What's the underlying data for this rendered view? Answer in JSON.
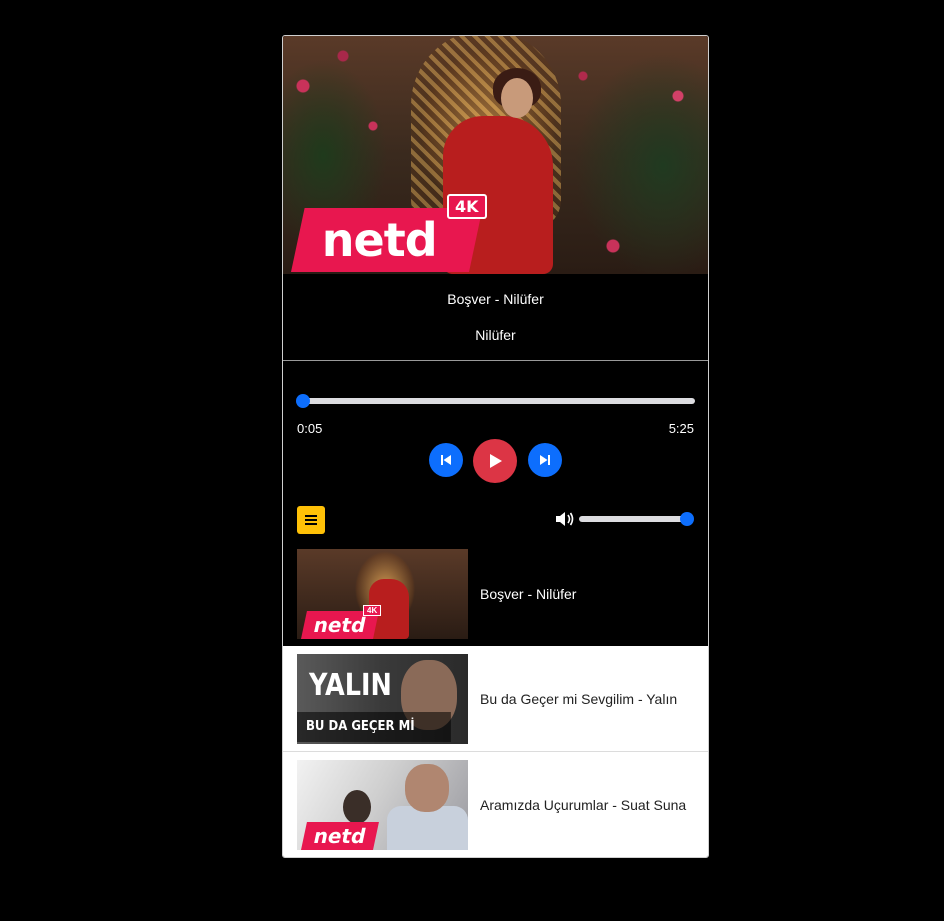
{
  "now_playing": {
    "title": "Boşver - Nilüfer",
    "artist": "Nilüfer",
    "cover_logo_text": "netd",
    "cover_badge": "4K"
  },
  "progress": {
    "current_time": "0:05",
    "duration": "5:25",
    "fraction": 0.015
  },
  "controls": {
    "prev_icon": "skip-back-icon",
    "play_icon": "play-icon",
    "next_icon": "skip-forward-icon",
    "list_icon": "list-icon",
    "volume_icon": "volume-icon"
  },
  "volume": {
    "level": 1.0
  },
  "playlist": [
    {
      "label": "Boşver - Nilüfer",
      "active": true,
      "thumb_logo": "netd",
      "thumb_badge": "4K"
    },
    {
      "label": "Bu da Geçer mi Sevgilim - Yalın",
      "active": false,
      "thumb_title": "YALIN",
      "thumb_subtitle": "BU DA GEÇER Mİ SEVGİLİM"
    },
    {
      "label": "Aramızda Uçurumlar - Suat Suna",
      "active": false,
      "thumb_logo": "netd"
    }
  ],
  "colors": {
    "accent_blue": "#0d6efd",
    "play_red": "#dc3545",
    "list_yellow": "#ffc107",
    "netd_pink": "#e8174f"
  }
}
